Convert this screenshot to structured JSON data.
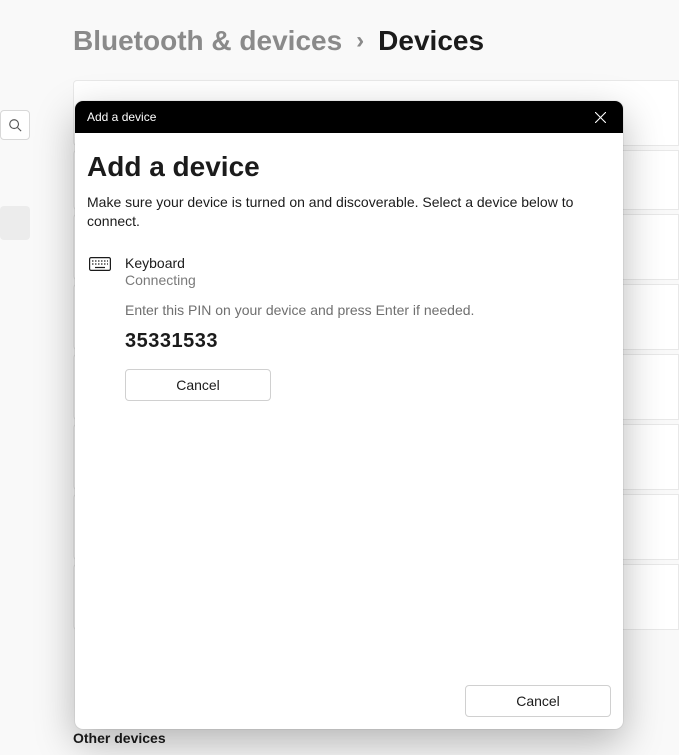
{
  "breadcrumb": {
    "parent": "Bluetooth & devices",
    "separator": "›",
    "current": "Devices"
  },
  "background": {
    "other_devices_label": "Other devices"
  },
  "dialog": {
    "titlebar": "Add a device",
    "heading": "Add a device",
    "subtext": "Make sure your device is turned on and discoverable. Select a device below to connect.",
    "device": {
      "name": "Keyboard",
      "status": "Connecting",
      "pin_instruction": "Enter this PIN on your device and press Enter if needed.",
      "pin": "35331533",
      "cancel_label": "Cancel"
    },
    "footer": {
      "cancel_label": "Cancel"
    }
  }
}
